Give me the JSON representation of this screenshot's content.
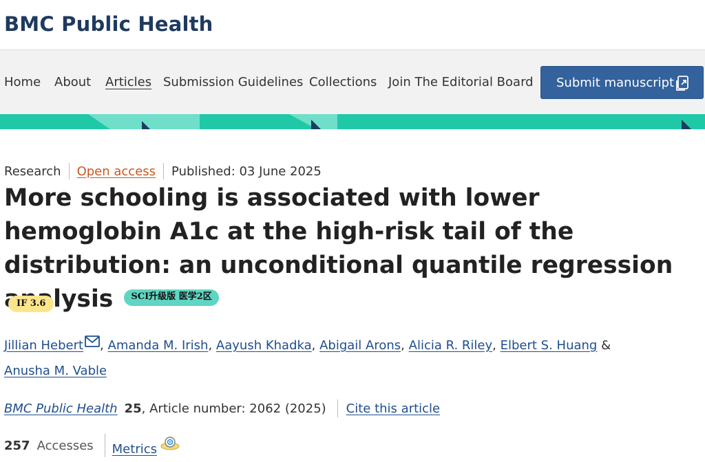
{
  "header": {
    "journal_title": "BMC Public Health"
  },
  "nav": {
    "items": [
      {
        "label": "Home"
      },
      {
        "label": "About"
      },
      {
        "label": "Articles"
      },
      {
        "label": "Submission Guidelines"
      },
      {
        "label": "Collections"
      },
      {
        "label": "Join The Editorial Board"
      }
    ],
    "active": "Articles",
    "submit_label": "Submit manuscript"
  },
  "article": {
    "type": "Research",
    "access": "Open access",
    "published": "Published: 03 June 2025",
    "title": "More schooling is associated with lower hemoglobin A1c at the high-risk tail of the distribution: an unconditional quantile regression analysis",
    "sci_badge": "SCI升级版 医学2区",
    "if_badge": "IF 3.6",
    "authors": [
      "Jillian Hebert",
      "Amanda M. Irish",
      "Aayush Khadka",
      "Abigail Arons",
      "Alicia R. Riley",
      "Elbert S. Huang",
      "Anusha M. Vable"
    ],
    "comma": ",",
    "ampersand": "&",
    "citation": {
      "journal": "BMC Public Health",
      "volume": "25",
      "rest": ", Article number: 2062 (2025)",
      "cite_label": "Cite this article"
    },
    "metrics": {
      "accesses_count": "257",
      "accesses_label": "Accesses",
      "metrics_label": "Metrics"
    }
  },
  "colors": {
    "brand": "#1f3a5f",
    "link": "#1f4e8c",
    "submit_button": "#33629d",
    "band": "#1fc9a8",
    "open_access": "#c8571f",
    "sci_badge": "#5fd6c3",
    "if_badge": "#fde58c"
  },
  "icons": [
    "mail-icon",
    "external-submit-icon",
    "metrics-icon"
  ]
}
